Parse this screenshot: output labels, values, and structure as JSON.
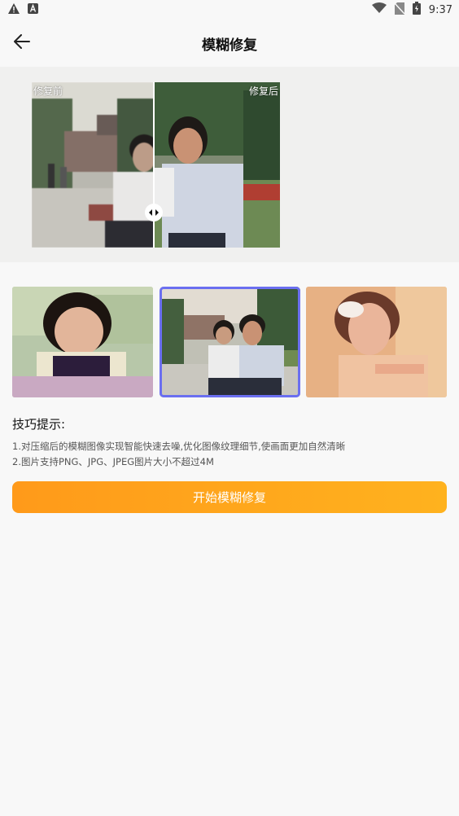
{
  "status_bar": {
    "time": "9:37",
    "icons": [
      "warning-icon",
      "a-badge-icon",
      "wifi-icon",
      "no-sim-icon",
      "battery-icon"
    ]
  },
  "header": {
    "title": "模糊修复",
    "back_icon": "arrow-left-icon"
  },
  "preview": {
    "before_label": "修复前",
    "after_label": "修复后",
    "handle_icon": "compare-drag-handle-icon"
  },
  "samples": [
    {
      "subject": "child",
      "selected": false
    },
    {
      "subject": "two-women-park",
      "selected": true
    },
    {
      "subject": "bride",
      "selected": false
    }
  ],
  "tips": {
    "title": "技巧提示:",
    "lines": [
      "1.对压缩后的模糊图像实现智能快速去噪,优化图像纹理细节,使画面更加自然清晰",
      "2.图片支持PNG、JPG、JPEG图片大小不超过4M"
    ]
  },
  "action": {
    "label": "开始模糊修复"
  },
  "colors": {
    "accent": "#6b6ff0",
    "button_start": "#ff9a1a",
    "button_end": "#ffb21e"
  }
}
